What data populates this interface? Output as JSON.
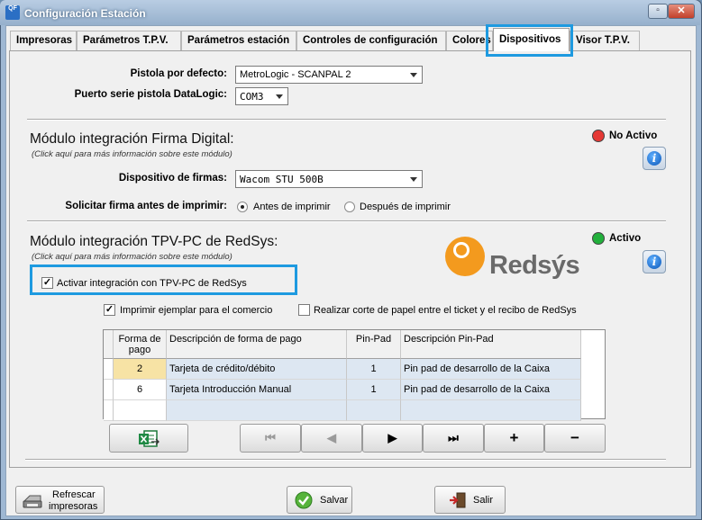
{
  "window": {
    "app_icon": "QF",
    "title": "Configuración Estación",
    "minimize_glyph": "▫",
    "close_glyph": "✕"
  },
  "tabs": [
    {
      "label": "Impresoras"
    },
    {
      "label": "Parámetros T.P.V."
    },
    {
      "label": "Parámetros estación"
    },
    {
      "label": "Controles de configuración"
    },
    {
      "label": "Colores"
    },
    {
      "label": "Dispositivos",
      "active": true
    },
    {
      "label": "Visor T.P.V."
    }
  ],
  "devices": {
    "pistol_label": "Pistola por defecto:",
    "pistol_value": "MetroLogic - SCANPAL 2",
    "serial_label": "Puerto serie pistola DataLogic:",
    "serial_value": "COM3"
  },
  "signature_module": {
    "title": "Módulo integración Firma Digital:",
    "hint": "(Click aquí para más información sobre este módulo)",
    "status": "No Activo",
    "status_color": "#e53935",
    "device_label": "Dispositivo de firmas:",
    "device_value": "Wacom STU 500B",
    "ask_label": "Solicitar firma antes de imprimir:",
    "option_before": "Antes de imprimir",
    "option_after": "Después de imprimir"
  },
  "redsys_module": {
    "title": "Módulo integración TPV-PC de RedSys:",
    "hint": "(Click aquí para más información sobre este módulo)",
    "status": "Activo",
    "status_color": "#22b03c",
    "logo_text": "Redsýs",
    "activate_label": "Activar integración con TPV-PC de RedSys",
    "print_copy_label": "Imprimir ejemplar para el comercio",
    "cut_paper_label": "Realizar corte de papel entre el ticket y el recibo de RedSys",
    "info_glyph": "i",
    "check_glyph": "✓"
  },
  "grid": {
    "headers": [
      "Forma de pago",
      "Descripción de forma de pago",
      "Pin-Pad",
      "Descripción Pin-Pad"
    ],
    "rows": [
      [
        "2",
        "Tarjeta de crédito/débito",
        "1",
        "Pin pad de desarrollo de la Caixa"
      ],
      [
        "6",
        "Tarjeta Introducción Manual",
        "1",
        "Pin pad de desarrollo de la Caixa"
      ]
    ]
  },
  "nav": {
    "first": "⏮",
    "prev": "◀",
    "next": "▶",
    "last": "⏭",
    "add": "+",
    "remove": "−"
  },
  "buttons": {
    "refresh_line1": "Refrescar",
    "refresh_line2": "impresoras",
    "save": "Salvar",
    "exit": "Salir"
  }
}
